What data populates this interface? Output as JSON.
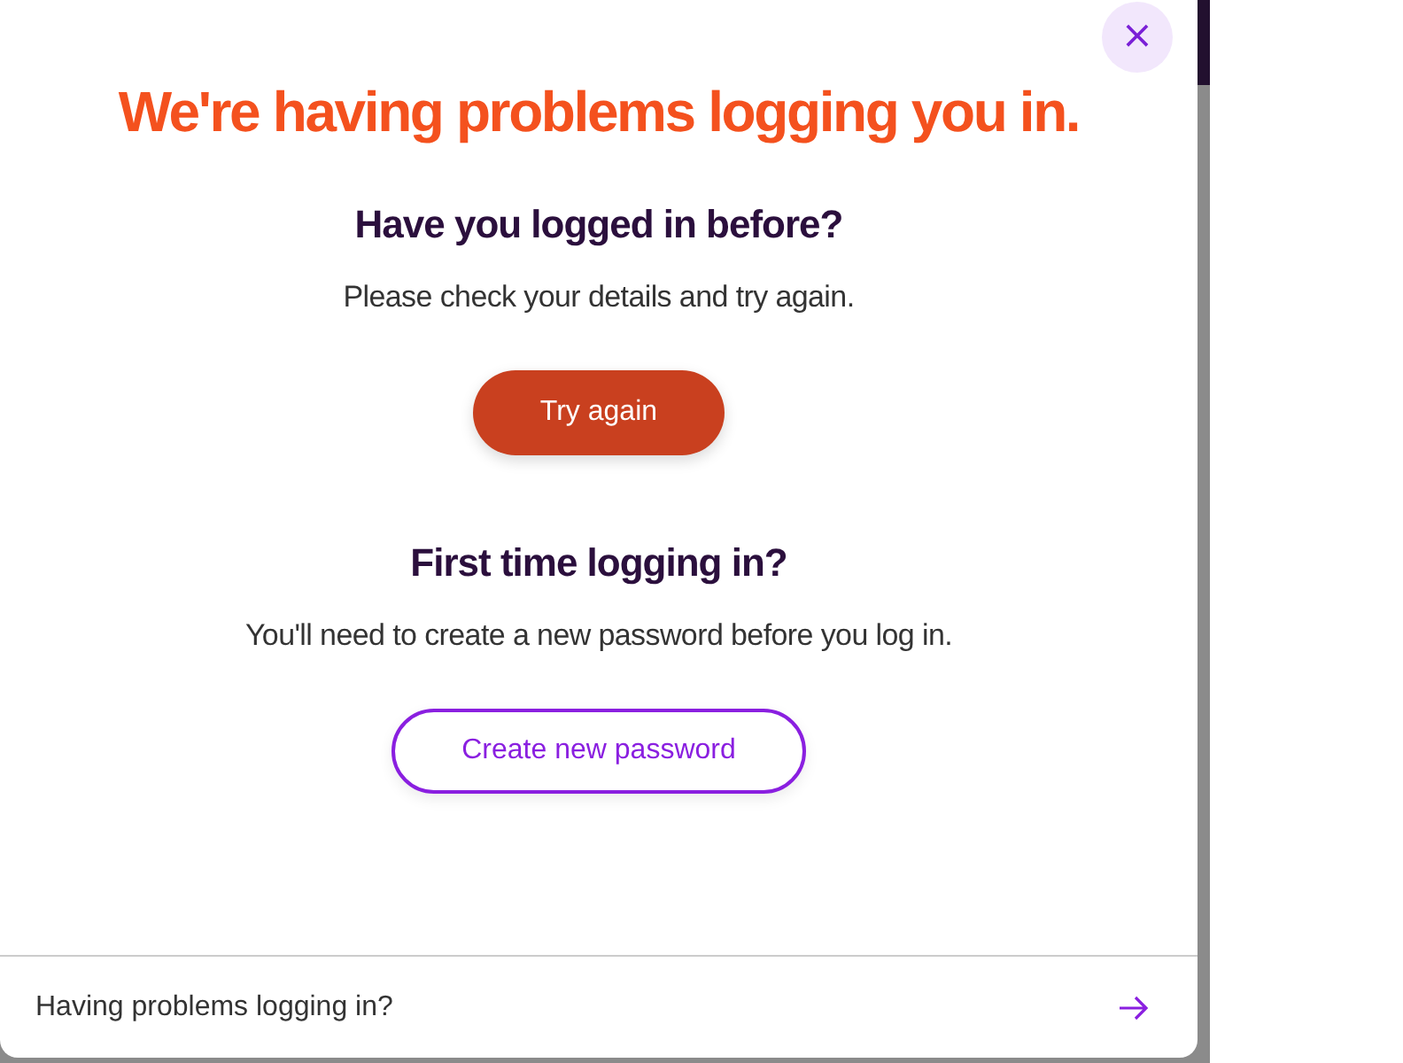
{
  "dialog": {
    "close_label": "×",
    "title": "We're having problems logging you in.",
    "sections": [
      {
        "heading": "Have you logged in before?",
        "text": "Please check your details and try again.",
        "button": {
          "label": "Try again",
          "kind": "primary"
        }
      },
      {
        "heading": "First time logging in?",
        "text": "You'll need to create a new password before you log in.",
        "button": {
          "label": "Create new password",
          "kind": "outline"
        }
      }
    ],
    "footer": {
      "link": "Having problems logging in?"
    }
  }
}
